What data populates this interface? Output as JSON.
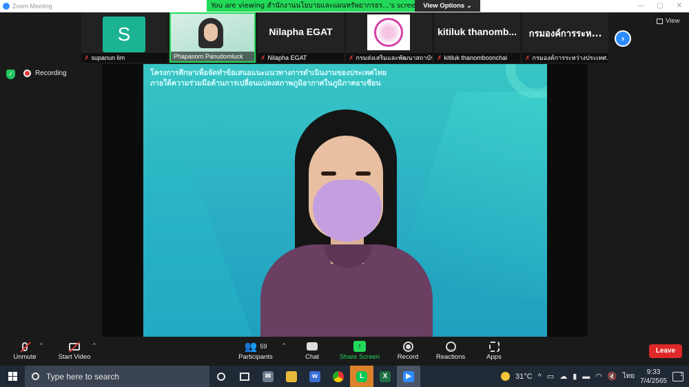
{
  "window": {
    "title": "Zoom Meeting"
  },
  "share_banner": {
    "text": "You are viewing สำนักงานนโยบายและแผนทรัพยากรธร...'s screen",
    "view_options": "View Options"
  },
  "participants_strip": [
    {
      "name": "supanun lim",
      "avatar_letter": "S",
      "avatar_color": "#1bb394",
      "muted": true,
      "type": "avatar"
    },
    {
      "name": "Phapasorn Panudomluck",
      "muted": false,
      "type": "video",
      "active_speaker": true
    },
    {
      "name": "Nilapha EGAT",
      "display": "Nilapha EGAT",
      "muted": true,
      "type": "name"
    },
    {
      "name": "กรมส่งเสริมและพัฒนาสถาบัน...",
      "muted": true,
      "type": "logo"
    },
    {
      "name": "kitiluk thanomboonchai",
      "display": "kitiluk  thanomb...",
      "muted": true,
      "type": "name"
    },
    {
      "name": "กรมองค์การระหว่างประเทศ...",
      "display": "กรมองค์การระห...",
      "muted": true,
      "type": "name"
    }
  ],
  "view_button": "View",
  "status": {
    "recording": "Recording",
    "security_color": "#22c55e"
  },
  "slide": {
    "title_line1": "โครงการศึกษาเพื่อจัดทำข้อเสนอแนะแนวทางการดำเนินงานของประเทศไทย",
    "title_line2": "ภายใต้ความร่วมมือด้านการเปลี่ยนแปลงสภาพภูมิอากาศในภูมิภาคอาเซียน"
  },
  "toolbar": {
    "unmute": "Unmute",
    "start_video": "Start Video",
    "participants": "Participants",
    "participants_count": "59",
    "chat": "Chat",
    "share_screen": "Share Screen",
    "record": "Record",
    "reactions": "Reactions",
    "apps": "Apps",
    "leave": "Leave"
  },
  "taskbar": {
    "search_placeholder": "Type here to search",
    "temperature": "31°C",
    "language": "ไทย",
    "time": "9:33",
    "date": "7/4/2565",
    "notifications": "1"
  },
  "colors": {
    "accent": "#2d8cff",
    "share_green": "#23d959",
    "leave_red": "#e02828"
  }
}
